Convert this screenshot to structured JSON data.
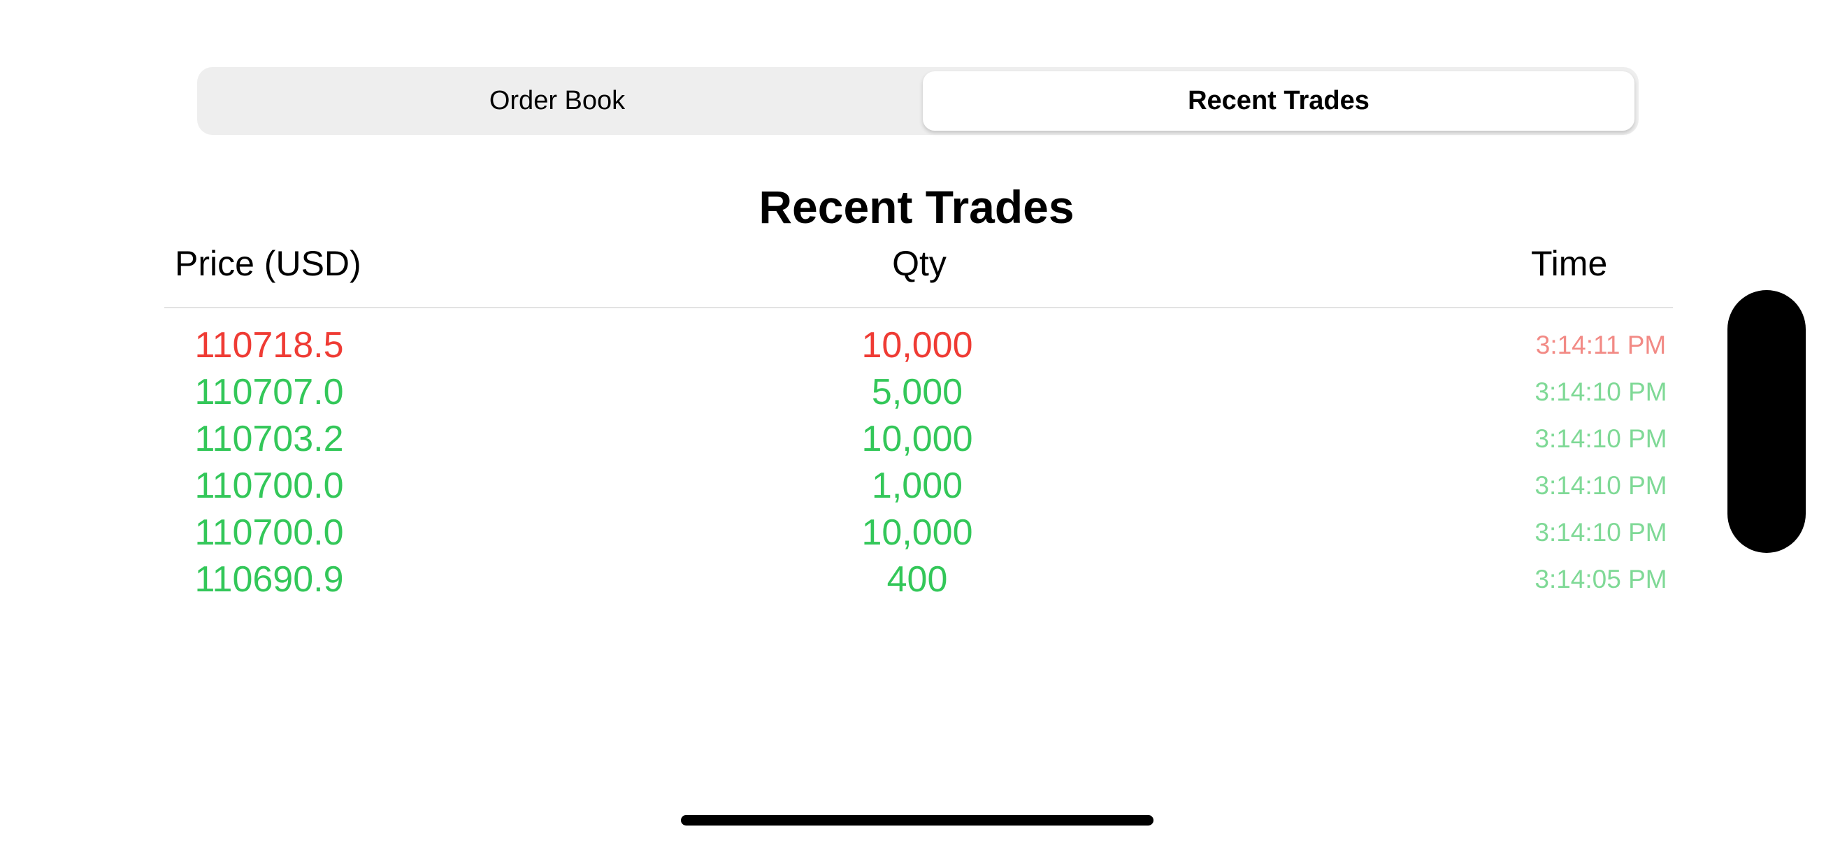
{
  "tabs": {
    "order_book": "Order Book",
    "recent_trades": "Recent Trades",
    "selected": "recent_trades"
  },
  "title": "Recent Trades",
  "columns": {
    "price": "Price (USD)",
    "qty": "Qty",
    "time": "Time"
  },
  "colors": {
    "sell": "#ef3b34",
    "buy": "#33c759"
  },
  "trades": [
    {
      "price": "110718.5",
      "qty": "10,000",
      "time": "3:14:11 PM",
      "side": "sell"
    },
    {
      "price": "110707.0",
      "qty": "5,000",
      "time": "3:14:10 PM",
      "side": "buy"
    },
    {
      "price": "110703.2",
      "qty": "10,000",
      "time": "3:14:10 PM",
      "side": "buy"
    },
    {
      "price": "110700.0",
      "qty": "1,000",
      "time": "3:14:10 PM",
      "side": "buy"
    },
    {
      "price": "110700.0",
      "qty": "10,000",
      "time": "3:14:10 PM",
      "side": "buy"
    },
    {
      "price": "110690.9",
      "qty": "400",
      "time": "3:14:05 PM",
      "side": "buy"
    }
  ]
}
